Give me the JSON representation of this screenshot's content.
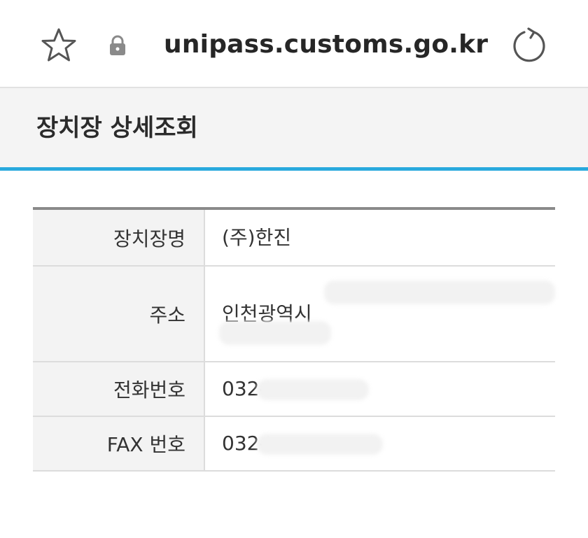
{
  "browser": {
    "url": "unipass.customs.go.kr",
    "icons": [
      "star-icon",
      "lock-icon",
      "reload-icon"
    ]
  },
  "page": {
    "title": "장치장 상세조회",
    "accent_color": "#29a9dd"
  },
  "details": {
    "rows": [
      {
        "label": "장치장명",
        "value": "(주)한진"
      },
      {
        "label": "주소",
        "value_line1": "인천광역시 ",
        "value_line2": ""
      },
      {
        "label": "전화번호",
        "value": "032-"
      },
      {
        "label": "FAX 번호",
        "value": "032-"
      }
    ]
  }
}
